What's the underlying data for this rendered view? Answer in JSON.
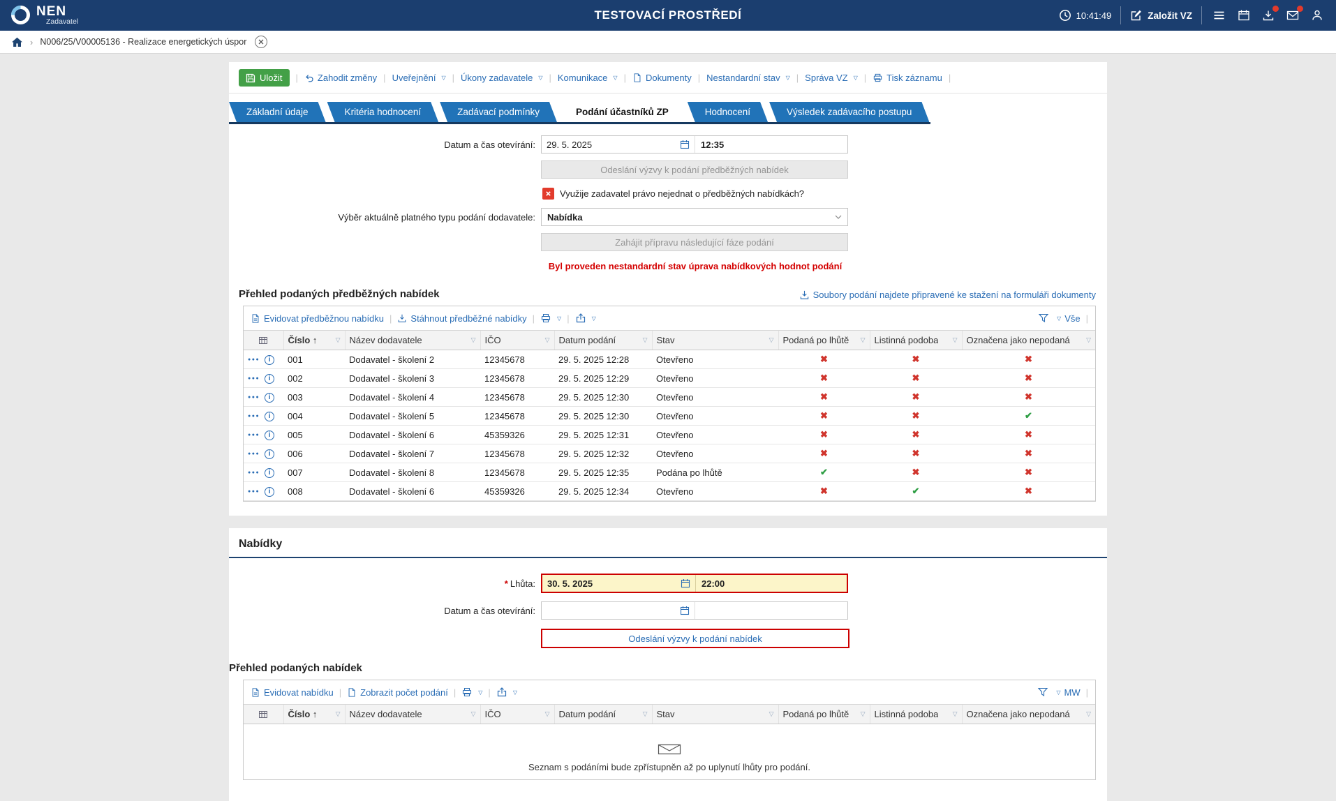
{
  "header": {
    "brand": "NEN",
    "brand_sub": "Zadavatel",
    "environment": "TESTOVACÍ PROSTŘEDÍ",
    "clock": "10:41:49",
    "new_vz": "Založit VZ"
  },
  "breadcrumb": {
    "item": "N006/25/V00005136 - Realizace energetických úspor"
  },
  "toolbar": {
    "save": "Uložit",
    "items": [
      {
        "label": "Zahodit změny"
      },
      {
        "label": "Uveřejnění"
      },
      {
        "label": "Úkony zadavatele"
      },
      {
        "label": "Komunikace"
      },
      {
        "label": "Dokumenty"
      },
      {
        "label": "Nestandardní stav"
      },
      {
        "label": "Správa VZ"
      },
      {
        "label": "Tisk záznamu"
      }
    ]
  },
  "tabs": [
    {
      "label": "Základní údaje",
      "active": false
    },
    {
      "label": "Kritéria hodnocení",
      "active": false
    },
    {
      "label": "Zadávací podmínky",
      "active": false
    },
    {
      "label": "Podání účastníků ZP",
      "active": true
    },
    {
      "label": "Hodnocení",
      "active": false
    },
    {
      "label": "Výsledek zadávacího postupu",
      "active": false
    }
  ],
  "phase_form": {
    "opening_label": "Datum a čas otevírání:",
    "opening_date": "29. 5. 2025",
    "opening_time": "12:35",
    "send_preliminary_invite": "Odeslání výzvy k podání předběžných nabídek",
    "no_negotiation_question": "Využije zadavatel právo nejednat o předběžných nabídkách?",
    "submission_type_label": "Výběr aktuálně platného typu podání dodavatele:",
    "submission_type_value": "Nabídka",
    "start_next_phase": "Zahájit přípravu následující fáze podání",
    "nonstandard_warning": "Byl proveden nestandardní stav úprava nabídkových hodnot podání"
  },
  "table_columns": [
    "Číslo",
    "Název dodavatele",
    "IČO",
    "Datum podání",
    "Stav",
    "Podaná po lhůtě",
    "Listinná podoba",
    "Označena jako nepodaná"
  ],
  "preliminary": {
    "title": "Přehled podaných předběžných nabídek",
    "files_link": "Soubory podání najdete připravené ke stažení na formuláři dokumenty",
    "actions": {
      "register": "Evidovat předběžnou nabídku",
      "download": "Stáhnout předběžné nabídky",
      "view": "Vše"
    },
    "rows": [
      {
        "cislo": "001",
        "nazev": "Dodavatel - školení 2",
        "ico": "12345678",
        "datum": "29. 5. 2025 12:28",
        "stav": "Otevřeno",
        "po_lhute": false,
        "listinna": false,
        "nepodana": false
      },
      {
        "cislo": "002",
        "nazev": "Dodavatel - školení 3",
        "ico": "12345678",
        "datum": "29. 5. 2025 12:29",
        "stav": "Otevřeno",
        "po_lhute": false,
        "listinna": false,
        "nepodana": false
      },
      {
        "cislo": "003",
        "nazev": "Dodavatel - školení 4",
        "ico": "12345678",
        "datum": "29. 5. 2025 12:30",
        "stav": "Otevřeno",
        "po_lhute": false,
        "listinna": false,
        "nepodana": false
      },
      {
        "cislo": "004",
        "nazev": "Dodavatel - školení 5",
        "ico": "12345678",
        "datum": "29. 5. 2025 12:30",
        "stav": "Otevřeno",
        "po_lhute": false,
        "listinna": false,
        "nepodana": true
      },
      {
        "cislo": "005",
        "nazev": "Dodavatel - školení 6",
        "ico": "45359326",
        "datum": "29. 5. 2025 12:31",
        "stav": "Otevřeno",
        "po_lhute": false,
        "listinna": false,
        "nepodana": false
      },
      {
        "cislo": "006",
        "nazev": "Dodavatel - školení 7",
        "ico": "12345678",
        "datum": "29. 5. 2025 12:32",
        "stav": "Otevřeno",
        "po_lhute": false,
        "listinna": false,
        "nepodana": false
      },
      {
        "cislo": "007",
        "nazev": "Dodavatel - školení 8",
        "ico": "12345678",
        "datum": "29. 5. 2025 12:35",
        "stav": "Podána po lhůtě",
        "po_lhute": true,
        "listinna": false,
        "nepodana": false
      },
      {
        "cislo": "008",
        "nazev": "Dodavatel - školení 6",
        "ico": "45359326",
        "datum": "29. 5. 2025 12:34",
        "stav": "Otevřeno",
        "po_lhute": false,
        "listinna": true,
        "nepodana": false
      }
    ]
  },
  "offers": {
    "section_title": "Nabídky",
    "deadline_label": "Lhůta:",
    "deadline_date": "30. 5. 2025",
    "deadline_time": "22:00",
    "opening_label": "Datum a čas otevírání:",
    "send_invite": "Odeslání výzvy k podání nabídek",
    "overview_title": "Přehled podaných nabídek",
    "actions": {
      "register": "Evidovat nabídku",
      "count": "Zobrazit počet podání",
      "view": "MW"
    },
    "empty_text": "Seznam s podáními bude zpřístupněn až po uplynutí lhůty pro podání."
  }
}
